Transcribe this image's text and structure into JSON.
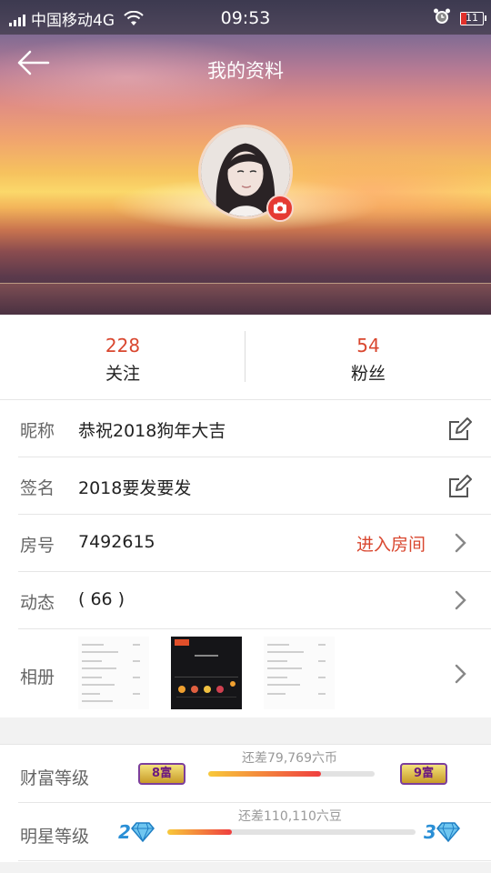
{
  "status_bar": {
    "carrier": "中国移动4G",
    "time": "09:53",
    "battery": "11"
  },
  "header": {
    "title": "我的资料"
  },
  "stats": {
    "following": {
      "count": "228",
      "label": "关注"
    },
    "fans": {
      "count": "54",
      "label": "粉丝"
    }
  },
  "profile": {
    "nickname": {
      "label": "昵称",
      "value": "恭祝2018狗年大吉"
    },
    "signature": {
      "label": "签名",
      "value": "2018要发要发"
    },
    "room": {
      "label": "房号",
      "value": "7492615",
      "action": "进入房间"
    },
    "feed": {
      "label": "动态",
      "value": "( 66 )"
    },
    "album": {
      "label": "相册"
    }
  },
  "levels": {
    "wealth": {
      "label": "财富等级",
      "note": "还差79,769六币",
      "current": "8富",
      "next": "9富",
      "progress": 0.68
    },
    "star": {
      "label": "明星等级",
      "note": "还差110,110六豆",
      "current": "2",
      "next": "3",
      "progress": 0.26
    }
  },
  "colors": {
    "accent": "#d9472f",
    "camera_badge": "#e53a32"
  }
}
